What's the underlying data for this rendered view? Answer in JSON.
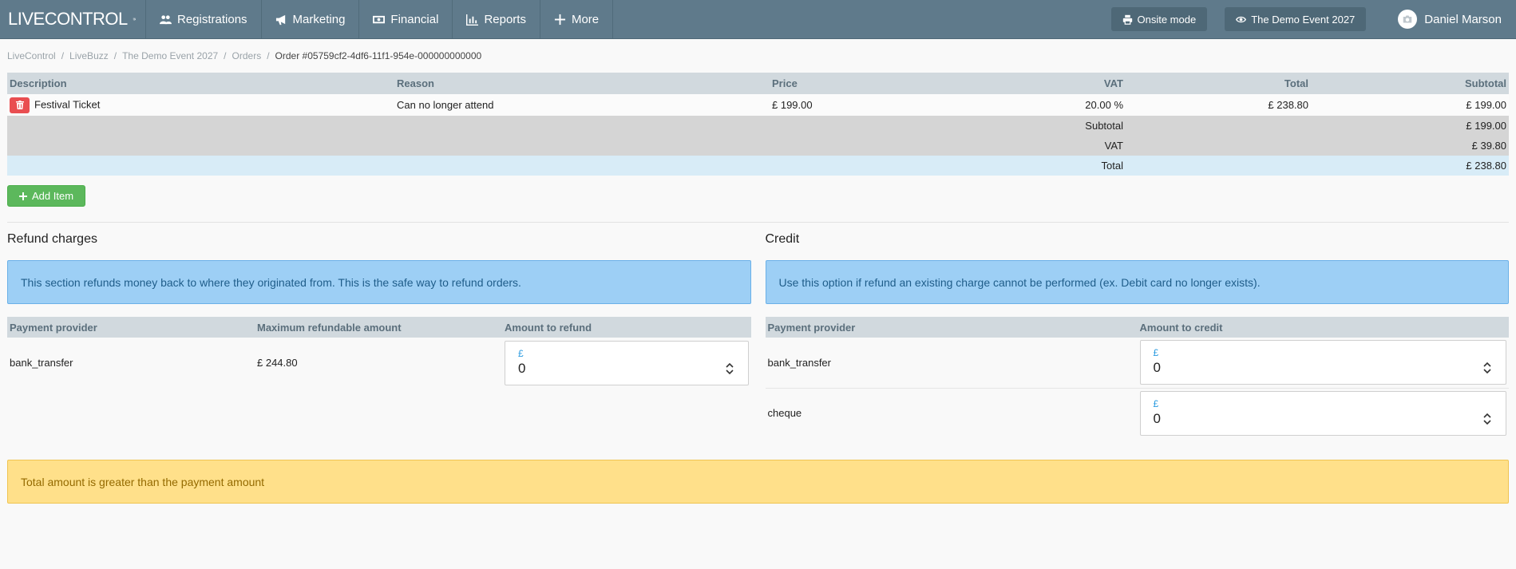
{
  "brand": {
    "part1": "LIVE",
    "part2": "CONTROL"
  },
  "nav": [
    {
      "label": "Registrations",
      "icon": "users-icon"
    },
    {
      "label": "Marketing",
      "icon": "megaphone-icon"
    },
    {
      "label": "Financial",
      "icon": "money-icon"
    },
    {
      "label": "Reports",
      "icon": "bar-chart-icon"
    },
    {
      "label": "More",
      "icon": "plus-icon"
    }
  ],
  "nav_right": {
    "onsite": "Onsite mode",
    "event": "The Demo Event 2027",
    "user": "Daniel Marson"
  },
  "breadcrumb": [
    "LiveControl",
    "LiveBuzz",
    "The Demo Event 2027",
    "Orders",
    "Order #05759cf2-4df6-11f1-954e-000000000000"
  ],
  "items_table": {
    "headers": [
      "Description",
      "Reason",
      "Price",
      "VAT",
      "Total",
      "Subtotal"
    ],
    "rows": [
      {
        "description": "Festival Ticket",
        "reason": "Can no longer attend",
        "price": "£ 199.00",
        "vat": "20.00 %",
        "total": "£ 238.80",
        "subtotal": "£ 199.00"
      }
    ],
    "summary": [
      {
        "label": "Subtotal",
        "value": "£ 199.00"
      },
      {
        "label": "VAT",
        "value": "£ 39.80"
      }
    ],
    "total": {
      "label": "Total",
      "value": "£ 238.80"
    }
  },
  "add_item_label": "Add Item",
  "refund": {
    "title": "Refund charges",
    "info": "This section refunds money back to where they originated from. This is the safe way to refund orders.",
    "headers": [
      "Payment provider",
      "Maximum refundable amount",
      "Amount to refund"
    ],
    "rows": [
      {
        "provider": "bank_transfer",
        "max": "£ 244.80",
        "currency": "£",
        "amount": "0"
      }
    ]
  },
  "credit": {
    "title": "Credit",
    "info": "Use this option if refund an existing charge cannot be performed (ex. Debit card no longer exists).",
    "headers": [
      "Payment provider",
      "Amount to credit"
    ],
    "rows": [
      {
        "provider": "bank_transfer",
        "currency": "£",
        "amount": "0"
      },
      {
        "provider": "cheque",
        "currency": "£",
        "amount": "0"
      }
    ]
  },
  "warning": "Total amount is greater than the payment amount",
  "colors": {
    "navbar": "#5f7a8b",
    "danger": "#e94e51",
    "success": "#5cb85c",
    "info": "#9dcff5",
    "warning": "#ffe08a"
  }
}
